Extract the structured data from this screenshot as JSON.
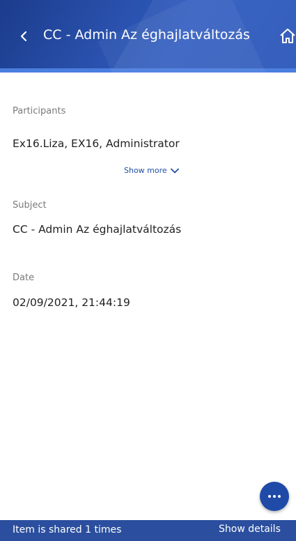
{
  "header": {
    "title": "CC - Admin Az éghajlatváltozás",
    "back_icon": "chevron-left-icon",
    "home_icon": "home-icon",
    "color": "#2a52ae"
  },
  "participants": {
    "label": "Participants",
    "value": "Ex16.Liza, EX16, Administrator",
    "show_more": "Show more",
    "show_more_icon": "chevron-down-icon"
  },
  "subject": {
    "label": "Subject",
    "value": "CC - Admin Az éghajlatváltozás"
  },
  "date": {
    "label": "Date",
    "value": "02/09/2021, 21:44:19"
  },
  "fab": {
    "icon": "more-icon"
  },
  "bottom_bar": {
    "shared_text": "Item is shared 1 times",
    "details_label": "Show details",
    "color": "#2b4f9e"
  }
}
